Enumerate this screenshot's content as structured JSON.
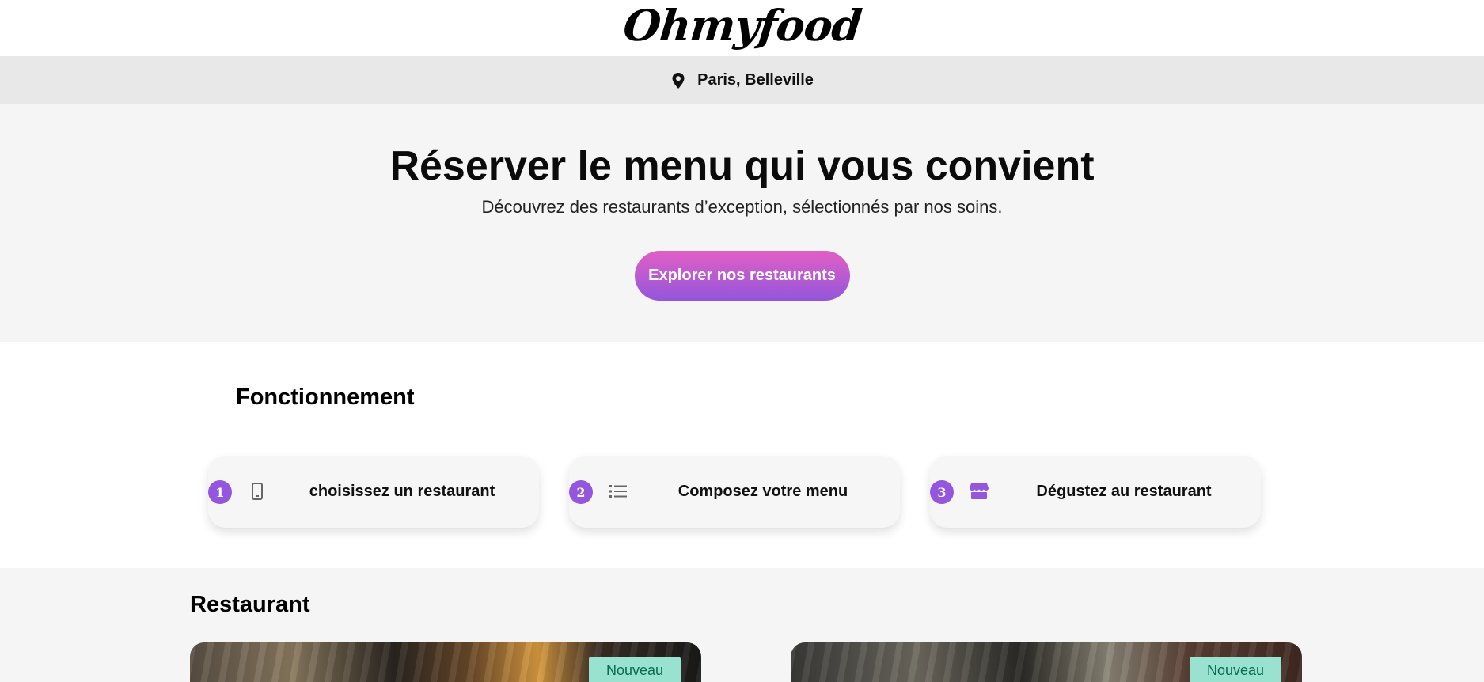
{
  "header": {
    "logo_text": "Ohmyfood"
  },
  "location": {
    "icon": "map-pin-icon",
    "text": "Paris, Belleville"
  },
  "hero": {
    "title": "Réserver le menu qui vous convient",
    "subtitle": "Découvrez des restaurants d’exception, sélectionnés par nos soins.",
    "cta_label": "Explorer nos restaurants"
  },
  "how": {
    "title": "Fonctionnement",
    "steps": [
      {
        "number": "1",
        "icon": "mobile-phone-icon",
        "label": "choisissez un restaurant"
      },
      {
        "number": "2",
        "icon": "list-icon",
        "label": "Composez votre menu"
      },
      {
        "number": "3",
        "icon": "store-icon",
        "label": "Dégustez au restaurant"
      }
    ]
  },
  "restaurants": {
    "title": "Restaurant",
    "cards": [
      {
        "badge": "Nouveau"
      },
      {
        "badge": "Nouveau"
      }
    ]
  },
  "colors": {
    "accent_purple": "#9356dc",
    "accent_pink": "#e25fc4",
    "badge_bg": "#99e2d0",
    "badge_text": "#0b6b4e"
  }
}
